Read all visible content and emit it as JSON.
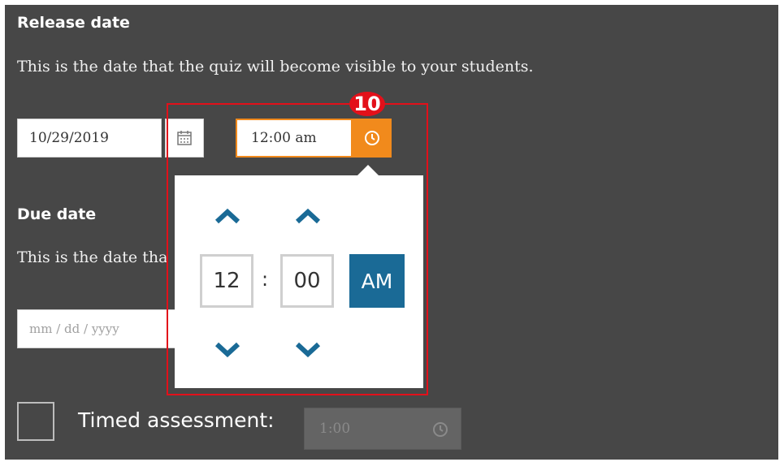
{
  "release": {
    "heading": "Release date",
    "description": "This is the date that the quiz will become visible to your students.",
    "date_value": "10/29/2019",
    "time_value": "12:00 am"
  },
  "annotation": {
    "step_number": "10"
  },
  "time_picker": {
    "hour": "12",
    "separator": ":",
    "minute": "00",
    "meridiem": "AM"
  },
  "due": {
    "heading": "Due date",
    "description_visible": "This is the date tha",
    "date_placeholder": "mm / dd / yyyy"
  },
  "timed": {
    "label": "Timed assessment:",
    "value": "1:00"
  },
  "colors": {
    "panel_bg": "#474747",
    "accent_orange": "#f18a1c",
    "ampm_blue": "#1a6a96",
    "chevron_blue": "#1a6a96",
    "annotation_red": "#e3101a"
  },
  "icons": {
    "calendar": "calendar-icon",
    "clock": "clock-icon",
    "chevron_up": "chevron-up-icon",
    "chevron_down": "chevron-down-icon"
  }
}
